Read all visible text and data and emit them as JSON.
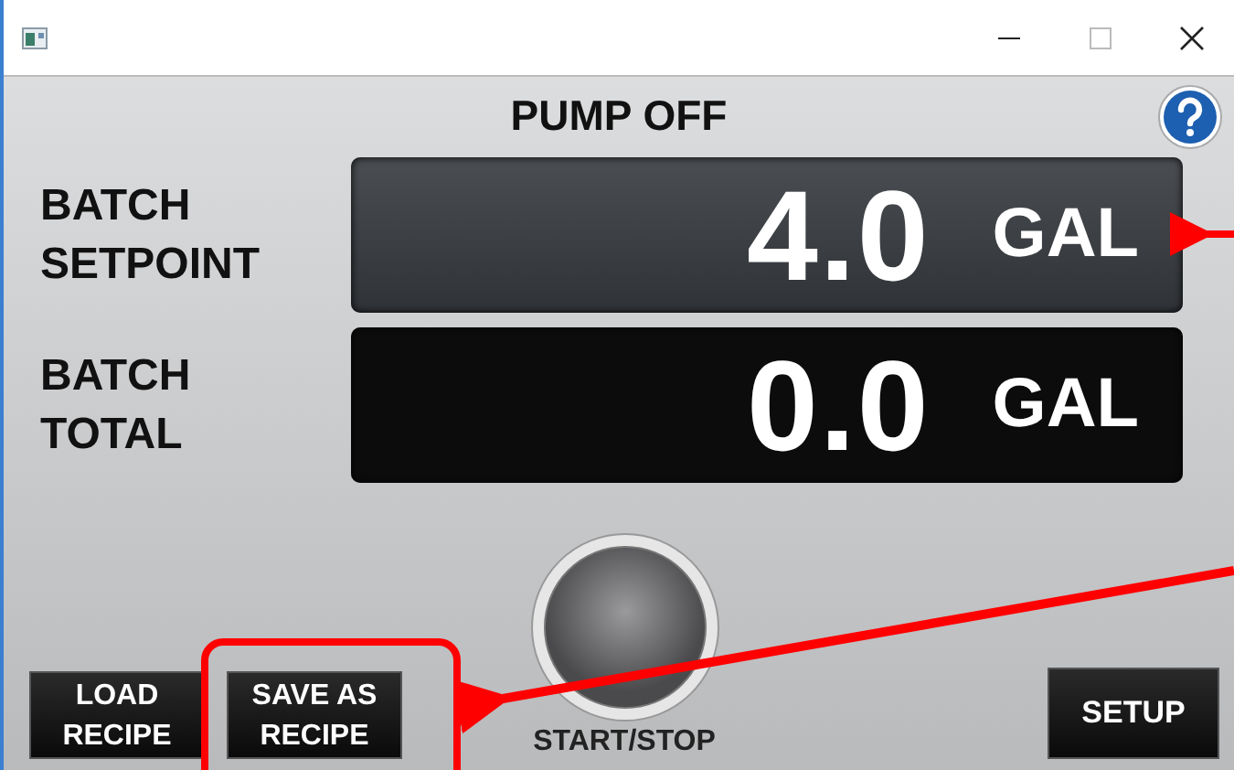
{
  "status": "PUMP OFF",
  "readouts": [
    {
      "label_lines": [
        "BATCH",
        "SETPOINT"
      ],
      "value": "4.0",
      "unit": "GAL",
      "kind": "setpoint"
    },
    {
      "label_lines": [
        "BATCH",
        "TOTAL"
      ],
      "value": "0.0",
      "unit": "GAL",
      "kind": "total"
    }
  ],
  "start_stop": {
    "label": "START/STOP"
  },
  "left_buttons": [
    {
      "lines": [
        "LOAD",
        "RECIPE"
      ]
    },
    {
      "lines": [
        "SAVE AS",
        "RECIPE"
      ]
    }
  ],
  "right_button": {
    "label": "SETUP"
  }
}
